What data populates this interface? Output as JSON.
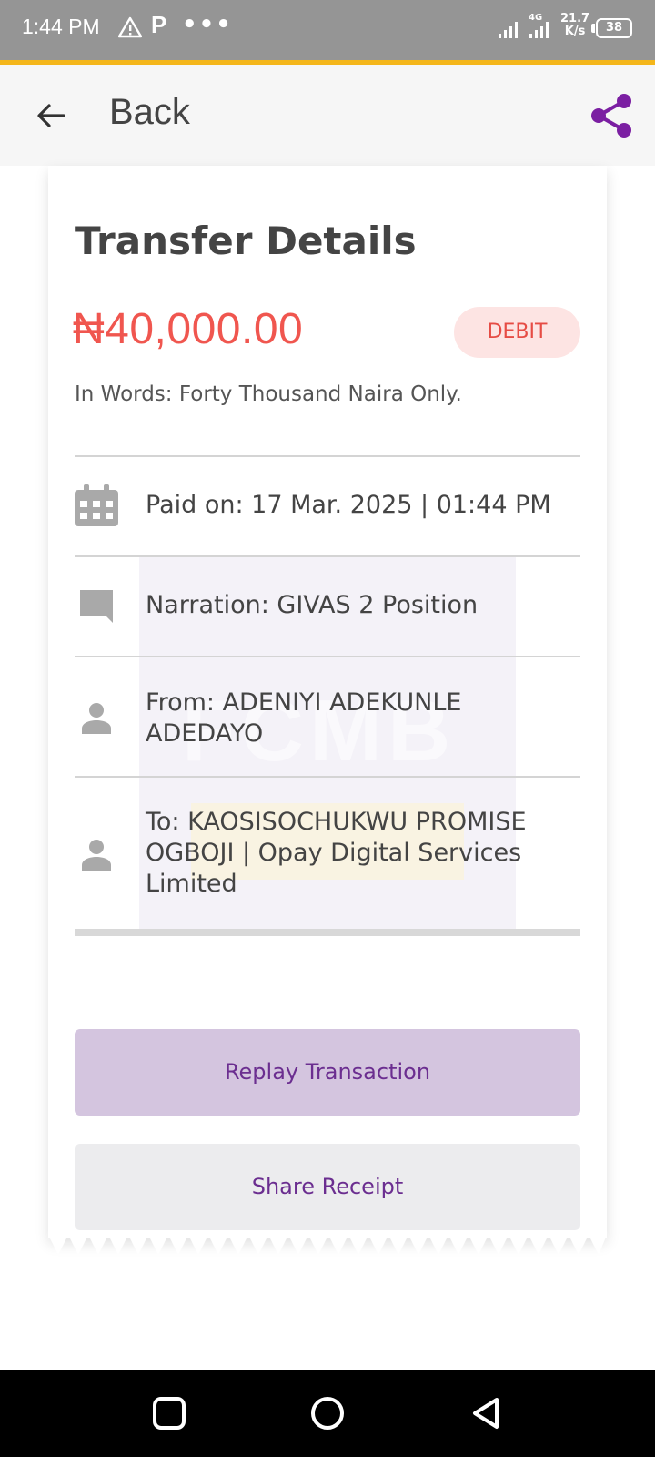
{
  "status_bar": {
    "time": "1:44 PM",
    "p_glyph": "P",
    "dots": "•••",
    "network": "4G",
    "speed": "21.7",
    "speed_unit": "K/s",
    "battery": "38",
    "icons": [
      "warning-icon",
      "signal-icon",
      "battery-icon"
    ]
  },
  "header": {
    "back_label": "Back",
    "icons": [
      "back-arrow-icon",
      "share-icon"
    ],
    "accent_color": "#7b1fa2"
  },
  "receipt": {
    "title": "Transfer Details",
    "amount": "₦40,000.00",
    "type_badge": "DEBIT",
    "amount_color": "#f0564f",
    "in_words": "In Words: Forty Thousand Naira  Only.",
    "watermark": "FCMB",
    "rows": [
      {
        "icon": "calendar-icon",
        "text": "Paid on: 17 Mar. 2025 | 01:44 PM"
      },
      {
        "icon": "comment-icon",
        "text": "Narration: GIVAS 2 Position"
      },
      {
        "icon": "person-icon",
        "text": "From: ADENIYI ADEKUNLE ADEDAYO"
      },
      {
        "icon": "person-icon",
        "text": "To: KAOSISOCHUKWU PROMISE OGBOJI | Opay Digital Services Limited"
      }
    ]
  },
  "actions": {
    "replay_label": "Replay Transaction",
    "share_label": "Share Receipt"
  },
  "nav_bar": {
    "icons": [
      "recent-apps-icon",
      "home-icon",
      "back-triangle-icon"
    ]
  }
}
